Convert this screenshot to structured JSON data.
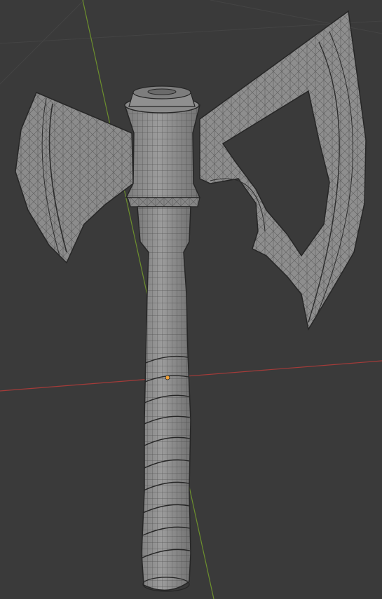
{
  "viewport": {
    "view": "3D Viewport",
    "shading": "wireframe-over-solid",
    "object": "axe",
    "colors": {
      "background": "#3a3a3a",
      "grid": "#474747",
      "axis_x": "#b0403e",
      "axis_y": "#6c8f2d",
      "mesh_fill": "#8a8a8a",
      "mesh_fill_light": "#9a9a9a",
      "mesh_fill_dark": "#6e6e6e",
      "wire": "#2c2c2c",
      "origin": "#f2a33a"
    }
  }
}
